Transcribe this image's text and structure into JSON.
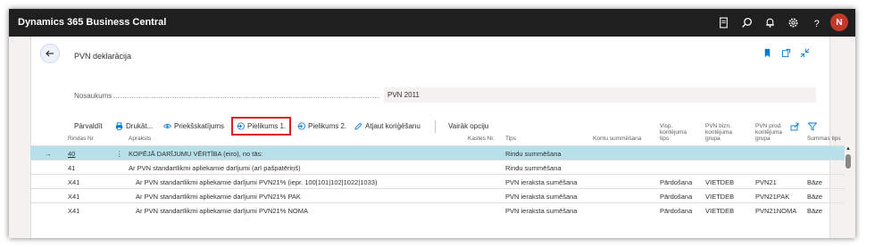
{
  "app": {
    "title": "Dynamics 365 Business Central",
    "avatar_initial": "N"
  },
  "topbar_icons": [
    "document-icon",
    "search-icon",
    "bell-icon",
    "gear-icon",
    "help-icon"
  ],
  "page": {
    "title": "PVN deklarācija"
  },
  "field": {
    "label": "Nosaukums",
    "value": "PVN 2011"
  },
  "actions": {
    "manage": "Pārvaldīt",
    "print": "Drukāt...",
    "preview": "Priekšskatījums",
    "appendix1": "Pielikums 1.",
    "appendix2": "Pielikums 2.",
    "cancel_correction": "Atjaut koriģēšanu",
    "more": "Vairāk opciju"
  },
  "table": {
    "headers": {
      "row_no": "Rindas Nr.",
      "description": "Apraksts",
      "box_no": "Kastes Nr.",
      "type": "Tips",
      "account_totaling": "Kontu summēšana",
      "vat_posting_type_1": "Visp.",
      "vat_posting_type_2": "kontējuma",
      "vat_posting_type_3": "tips",
      "vat_bus_group_1": "PVN bizn.",
      "vat_bus_group_2": "kontējuma",
      "vat_bus_group_3": "grupa",
      "vat_prod_group_1": "PVN prod.",
      "vat_prod_group_2": "kontējuma",
      "vat_prod_group_3": "grupa",
      "amount_type": "Summas tips"
    },
    "rows": [
      {
        "row_no": "40",
        "description": "KOPĒJĀ DARĪJUMU VĒRTĪBA (eiro), no tās:",
        "type": "Rindu summēšana",
        "posting_type": "",
        "bus_group": "",
        "prod_group": "",
        "amount_type": ""
      },
      {
        "row_no": "41",
        "description": "Ar PVN standartlikmi apliekamie darījumi (arī pašpatēriņš)",
        "type": "Rindu summēšana",
        "posting_type": "",
        "bus_group": "",
        "prod_group": "",
        "amount_type": ""
      },
      {
        "row_no": "X41",
        "description": "Ar PVN standartlikmi apliekamie darījumi PVN21% (iepr. 100|101|102|1022|1033)",
        "type": "PVN ieraksta sumēšana",
        "posting_type": "Pārdošana",
        "bus_group": "VIETDEB",
        "prod_group": "PVN21",
        "amount_type": "Bāze"
      },
      {
        "row_no": "X41",
        "description": "Ar PVN standartlikmi apliekamie darījumi PVN21% PAK",
        "type": "PVN ieraksta sumēšana",
        "posting_type": "Pārdošana",
        "bus_group": "VIETDEB",
        "prod_group": "PVN21PAK",
        "amount_type": "Bāze"
      },
      {
        "row_no": "X41",
        "description": "Ar PVN standartlikmi apliekamie darījumi PVN21% NOMA",
        "type": "PVN ieraksta sumēšana",
        "posting_type": "Pārdošana",
        "bus_group": "VIETDEB",
        "prod_group": "PVN21NOMA",
        "amount_type": "Bāze"
      }
    ]
  },
  "colors": {
    "accent": "#0078d4",
    "highlight": "#e02020",
    "selected_row": "#b7e0ea",
    "topbar": "#1f1f1f"
  }
}
